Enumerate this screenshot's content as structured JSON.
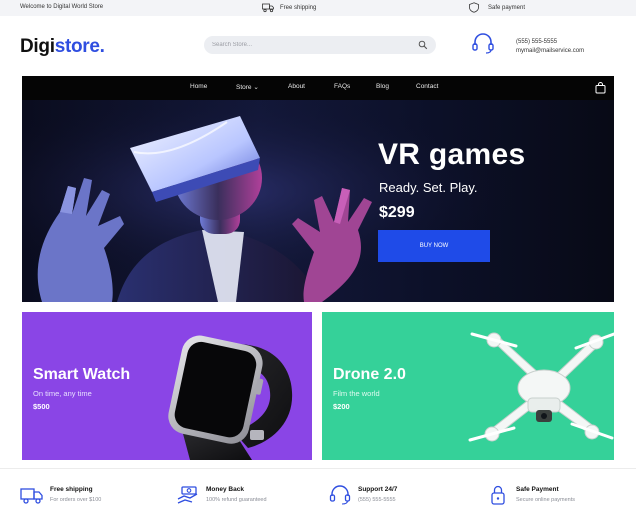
{
  "topbar": {
    "welcome": "Welcome to Digital World Store",
    "shipping": "Free shipping",
    "payment": "Safe payment"
  },
  "header": {
    "logo_part1": "Digi",
    "logo_part2": "store.",
    "search_placeholder": "Search Store...",
    "phone": "(555) 555-5555",
    "email": "mymail@mailservice.com"
  },
  "nav": {
    "items": [
      "Home",
      "Store ⌄",
      "About",
      "FAQs",
      "Blog",
      "Contact"
    ]
  },
  "hero": {
    "title": "VR games",
    "subtitle": "Ready. Set. Play.",
    "price": "$299",
    "button": "BUY NOW"
  },
  "promos": [
    {
      "title": "Smart Watch",
      "subtitle": "On time, any time",
      "price": "$500"
    },
    {
      "title": "Drone 2.0",
      "subtitle": "Film the world",
      "price": "$200"
    }
  ],
  "features": [
    {
      "title": "Free shipping",
      "subtitle": "For orders over $100",
      "icon": "truck-icon"
    },
    {
      "title": "Money Back",
      "subtitle": "100% refund guaranteed",
      "icon": "money-icon"
    },
    {
      "title": "Support 24/7",
      "subtitle": "(555) 555-5555",
      "icon": "headset-icon"
    },
    {
      "title": "Safe Payment",
      "subtitle": "Secure online payments",
      "icon": "lock-icon"
    }
  ],
  "colors": {
    "brand": "#2f4ee0",
    "button": "#1f4be8",
    "watch_card": "#8a45e6",
    "drone_card": "#35d199",
    "nav": "#050505"
  }
}
